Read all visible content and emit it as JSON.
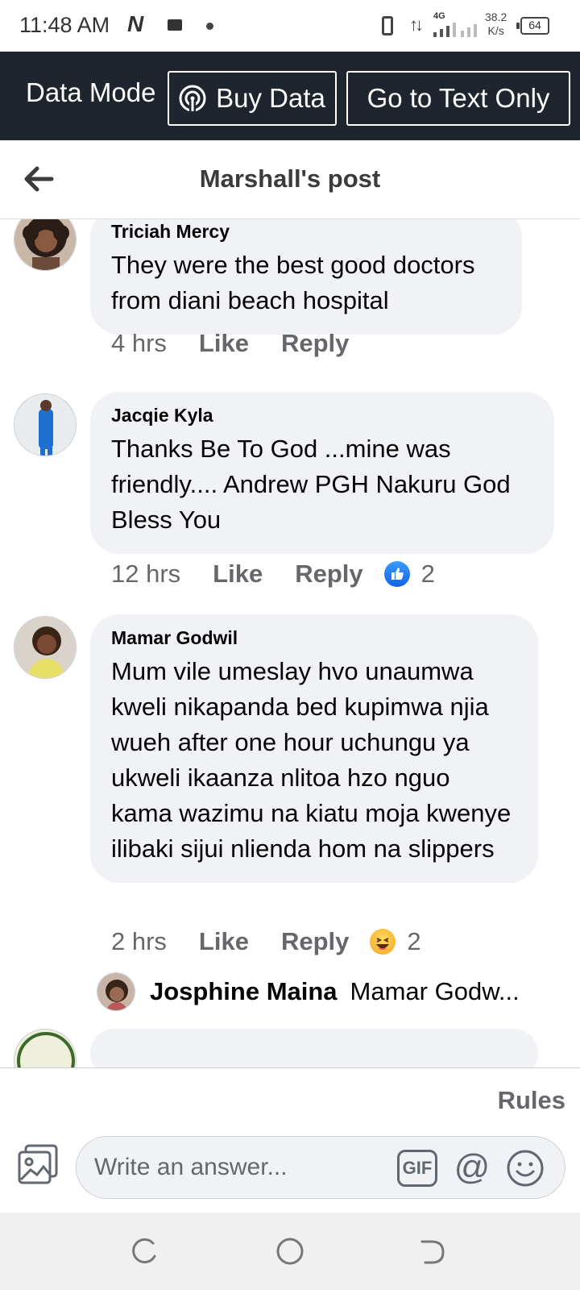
{
  "status_bar": {
    "time": "11:48 AM",
    "network_type": "4G",
    "speed": "38.2",
    "speed_unit": "K/s",
    "battery": "64"
  },
  "data_mode_bar": {
    "label": "Data Mode",
    "buy_data": "Buy Data",
    "text_only": "Go to Text Only"
  },
  "header": {
    "title": "Marshall's post"
  },
  "comments": [
    {
      "author": "Triciah Mercy",
      "text": "They were the best good doctors from diani beach hospital",
      "time": "4 hrs",
      "like": "Like",
      "reply": "Reply"
    },
    {
      "author": "Jacqie Kyla",
      "text": "Thanks Be To God ...mine was friendly.... Andrew PGH Nakuru God Bless You",
      "time": "12 hrs",
      "like": "Like",
      "reply": "Reply",
      "reaction": "like",
      "reaction_count": "2"
    },
    {
      "author": "Mamar Godwil",
      "text": "Mum vile umeslay hvo unaumwa kweli nikapanda bed kupimwa njia wueh after one hour uchungu ya ukweli ikaanza nlitoa hzo nguo kama wazimu na kiatu moja kwenye ilibaki sijui nlienda hom na slippers",
      "time": "2 hrs",
      "like": "Like",
      "reply": "Reply",
      "reaction": "haha",
      "reaction_count": "2",
      "reply_preview": {
        "author": "Josphine Maina",
        "text": "Mamar Godw..."
      }
    }
  ],
  "footer": {
    "rules": "Rules",
    "answer_placeholder": "Write an answer...",
    "gif": "GIF",
    "mention": "@"
  },
  "colors": {
    "data_bar": "#1f252e",
    "bubble": "#f0f2f5",
    "secondary_text": "#65676b",
    "like_blue": "#1877f2"
  }
}
